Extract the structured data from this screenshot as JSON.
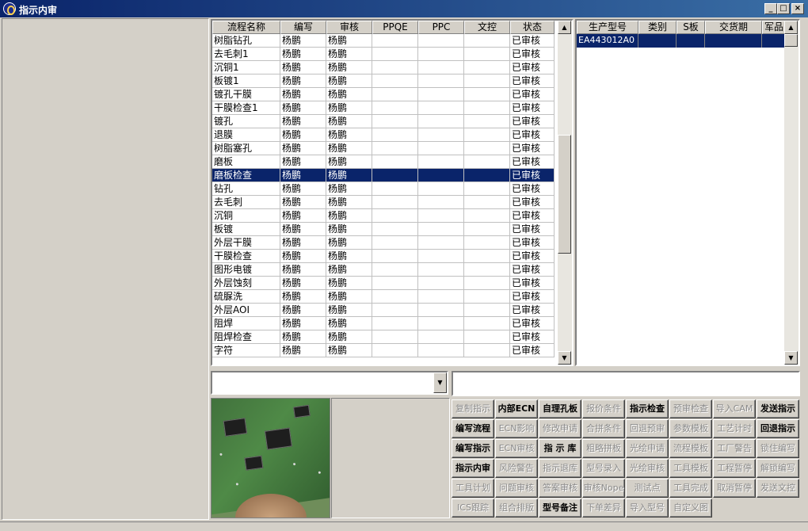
{
  "window": {
    "title": "指示内审",
    "minimize_glyph": "_",
    "maximize_glyph": "□",
    "close_glyph": "×"
  },
  "main_grid": {
    "columns": [
      "流程名称",
      "编写",
      "审核",
      "PPQE",
      "PPC",
      "文控",
      "状态"
    ],
    "selected_index": 10,
    "rows": [
      [
        "树脂钻孔",
        "杨鹏",
        "杨鹏",
        "",
        "",
        "",
        "已审核"
      ],
      [
        "去毛刺1",
        "杨鹏",
        "杨鹏",
        "",
        "",
        "",
        "已审核"
      ],
      [
        "沉铜1",
        "杨鹏",
        "杨鹏",
        "",
        "",
        "",
        "已审核"
      ],
      [
        "板镀1",
        "杨鹏",
        "杨鹏",
        "",
        "",
        "",
        "已审核"
      ],
      [
        "镀孔干膜",
        "杨鹏",
        "杨鹏",
        "",
        "",
        "",
        "已审核"
      ],
      [
        "干膜检查1",
        "杨鹏",
        "杨鹏",
        "",
        "",
        "",
        "已审核"
      ],
      [
        "镀孔",
        "杨鹏",
        "杨鹏",
        "",
        "",
        "",
        "已审核"
      ],
      [
        "退膜",
        "杨鹏",
        "杨鹏",
        "",
        "",
        "",
        "已审核"
      ],
      [
        "树脂塞孔",
        "杨鹏",
        "杨鹏",
        "",
        "",
        "",
        "已审核"
      ],
      [
        "磨板",
        "杨鹏",
        "杨鹏",
        "",
        "",
        "",
        "已审核"
      ],
      [
        "磨板检查",
        "杨鹏",
        "杨鹏",
        "",
        "",
        "",
        "已审核"
      ],
      [
        "钻孔",
        "杨鹏",
        "杨鹏",
        "",
        "",
        "",
        "已审核"
      ],
      [
        "去毛刺",
        "杨鹏",
        "杨鹏",
        "",
        "",
        "",
        "已审核"
      ],
      [
        "沉铜",
        "杨鹏",
        "杨鹏",
        "",
        "",
        "",
        "已审核"
      ],
      [
        "板镀",
        "杨鹏",
        "杨鹏",
        "",
        "",
        "",
        "已审核"
      ],
      [
        "外层干膜",
        "杨鹏",
        "杨鹏",
        "",
        "",
        "",
        "已审核"
      ],
      [
        "干膜检查",
        "杨鹏",
        "杨鹏",
        "",
        "",
        "",
        "已审核"
      ],
      [
        "图形电镀",
        "杨鹏",
        "杨鹏",
        "",
        "",
        "",
        "已审核"
      ],
      [
        "外层蚀刻",
        "杨鹏",
        "杨鹏",
        "",
        "",
        "",
        "已审核"
      ],
      [
        "硫脲洗",
        "杨鹏",
        "杨鹏",
        "",
        "",
        "",
        "已审核"
      ],
      [
        "外层AOI",
        "杨鹏",
        "杨鹏",
        "",
        "",
        "",
        "已审核"
      ],
      [
        "阻焊",
        "杨鹏",
        "杨鹏",
        "",
        "",
        "",
        "已审核"
      ],
      [
        "阻焊检查",
        "杨鹏",
        "杨鹏",
        "",
        "",
        "",
        "已审核"
      ],
      [
        "字符",
        "杨鹏",
        "杨鹏",
        "",
        "",
        "",
        "已审核"
      ]
    ]
  },
  "right_grid": {
    "columns": [
      "生产型号",
      "类别",
      "S板",
      "交货期",
      "军品"
    ],
    "rows": [
      [
        "EA443012A0",
        "",
        "",
        "",
        ""
      ]
    ]
  },
  "scroll_glyphs": {
    "up": "▲",
    "down": "▼"
  },
  "combo": {
    "value": "",
    "arrow": "▼"
  },
  "text_input": {
    "value": ""
  },
  "buttons": [
    {
      "label": "复制指示",
      "enabled": false
    },
    {
      "label": "内部ECN",
      "enabled": true
    },
    {
      "label": "自理孔板",
      "enabled": true
    },
    {
      "label": "报价条件",
      "enabled": false
    },
    {
      "label": "指示检查",
      "enabled": true
    },
    {
      "label": "预审检查",
      "enabled": false
    },
    {
      "label": "导入CAM",
      "enabled": false
    },
    {
      "label": "发送指示",
      "enabled": true
    },
    {
      "label": "编写流程",
      "enabled": true
    },
    {
      "label": "ECN影响",
      "enabled": false
    },
    {
      "label": "修改申请",
      "enabled": false
    },
    {
      "label": "合拼条件",
      "enabled": false
    },
    {
      "label": "回退预审",
      "enabled": false
    },
    {
      "label": "参数模板",
      "enabled": false
    },
    {
      "label": "工艺计时",
      "enabled": false
    },
    {
      "label": "回退指示",
      "enabled": true
    },
    {
      "label": "编写指示",
      "enabled": true
    },
    {
      "label": "ECN审核",
      "enabled": false
    },
    {
      "label": "指 示 库",
      "enabled": true
    },
    {
      "label": "粗略拼板",
      "enabled": false
    },
    {
      "label": "光绘申请",
      "enabled": false
    },
    {
      "label": "流程模板",
      "enabled": false
    },
    {
      "label": "工厂警告",
      "enabled": false
    },
    {
      "label": "锁住编写",
      "enabled": false
    },
    {
      "label": "指示内审",
      "enabled": true
    },
    {
      "label": "风险警告",
      "enabled": false
    },
    {
      "label": "指示退库",
      "enabled": false
    },
    {
      "label": "型号录入",
      "enabled": false
    },
    {
      "label": "光绘审核",
      "enabled": false
    },
    {
      "label": "工具模板",
      "enabled": false
    },
    {
      "label": "工程暂停",
      "enabled": false
    },
    {
      "label": "解锁编写",
      "enabled": false
    },
    {
      "label": "工具计划",
      "enabled": false
    },
    {
      "label": "问题审核",
      "enabled": false
    },
    {
      "label": "答案审核",
      "enabled": false
    },
    {
      "label": "审核Nope",
      "enabled": false
    },
    {
      "label": "测试点",
      "enabled": false
    },
    {
      "label": "工具完成",
      "enabled": false
    },
    {
      "label": "取消暂停",
      "enabled": false
    },
    {
      "label": "发送文控",
      "enabled": false
    },
    {
      "label": "ICS跟踪",
      "enabled": false
    },
    {
      "label": "组合排版",
      "enabled": false
    },
    {
      "label": "型号备注",
      "enabled": true
    },
    {
      "label": "下单差异",
      "enabled": false
    },
    {
      "label": "导入型号",
      "enabled": false
    },
    {
      "label": "自定义图",
      "enabled": false
    }
  ]
}
